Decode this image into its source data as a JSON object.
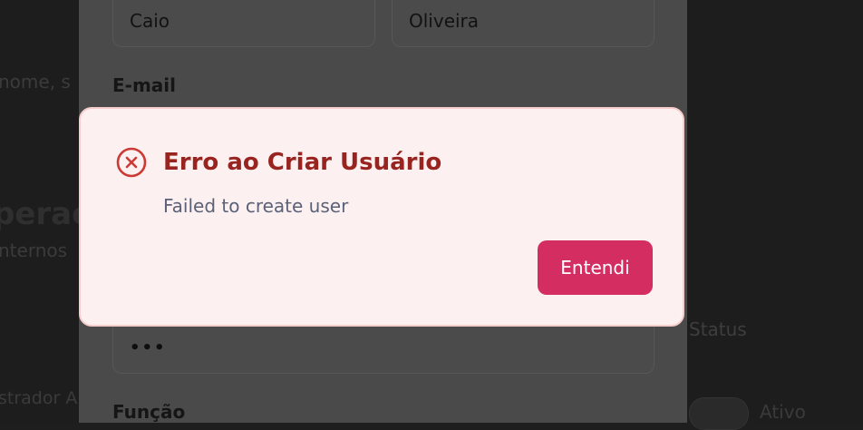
{
  "background": {
    "fragment_1": "nome, s",
    "fragment_2": "perac",
    "fragment_3": "nternos",
    "fragment_4": "strador A",
    "status_label": "Status",
    "toggle_label": "Ativo"
  },
  "form": {
    "first_name": "Caio",
    "last_name": "Oliveira",
    "email_label": "E-mail",
    "password_value": "•••",
    "role_label": "Função"
  },
  "dialog": {
    "title": "Erro ao Criar Usuário",
    "message": "Failed to create user",
    "confirm_label": "Entendi",
    "icon": "error-circle-x-icon",
    "colors": {
      "background": "#fcf1f0",
      "border": "#f6cdca",
      "title": "#98231f",
      "icon": "#cc3a35",
      "button": "#d42d62"
    }
  }
}
